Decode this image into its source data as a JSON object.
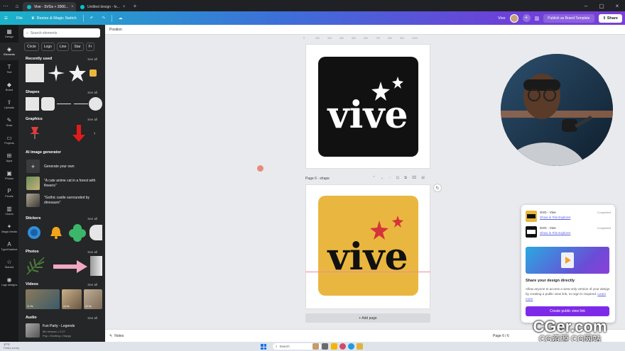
{
  "browser": {
    "tabs": [
      {
        "label": "Vive - SVGs + 2000..."
      },
      {
        "label": "Untitled design - fe..."
      }
    ]
  },
  "header": {
    "file": "File",
    "resize": "Resize & Magic Switch",
    "user_name": "Vive",
    "publish": "Publish as Brand Template",
    "share": "Share"
  },
  "rail": {
    "items": [
      {
        "label": "Design",
        "icon": "layout-icon"
      },
      {
        "label": "Elements",
        "icon": "shapes-icon"
      },
      {
        "label": "Text",
        "icon": "text-icon"
      },
      {
        "label": "Brand",
        "icon": "brand-icon"
      },
      {
        "label": "Uploads",
        "icon": "upload-icon"
      },
      {
        "label": "Draw",
        "icon": "pen-icon"
      },
      {
        "label": "Projects",
        "icon": "folder-icon"
      },
      {
        "label": "Apps",
        "icon": "apps-icon"
      },
      {
        "label": "Photos",
        "icon": "photo-icon"
      },
      {
        "label": "Pexels",
        "icon": "pexels-icon"
      },
      {
        "label": "Charts",
        "icon": "chart-icon"
      },
      {
        "label": "Magic Media",
        "icon": "magic-icon"
      },
      {
        "label": "TypeGradient",
        "icon": "type-icon"
      },
      {
        "label": "Starred",
        "icon": "star-icon"
      },
      {
        "label": "Logo designs",
        "icon": "logo-icon"
      }
    ]
  },
  "panel": {
    "search_placeholder": "Search elements",
    "chips": [
      "Circle",
      "Logo",
      "Line",
      "Star",
      "Fr"
    ],
    "see_all": "See all",
    "sections": {
      "recently_used": "Recently used",
      "shapes": "Shapes",
      "graphics": "Graphics",
      "ai_generator": "AI image generator",
      "stickers": "Stickers",
      "photos": "Photos",
      "videos": "Videos",
      "audio": "Audio"
    },
    "ai": {
      "generate": "Generate your own",
      "prompt1": "\"A cute anime cat in a forest with flowers\"",
      "prompt2": "\"Gothic castle surrounded by dinosaurs\""
    },
    "videos": [
      {
        "duration": "11.0s"
      },
      {
        "duration": "14.0s"
      },
      {
        "duration": "12.0s"
      }
    ],
    "audio": {
      "title": "Fun Party - Legends",
      "artist": "5th Heaven • 2:27",
      "tags": "Pop • Exciting • Happy"
    }
  },
  "canvas": {
    "position": "Position",
    "ruler": [
      "0",
      "200",
      "300",
      "400",
      "500",
      "600",
      "700",
      "800",
      "900",
      "1000"
    ],
    "page6_label": "Page 6 - shape",
    "add_page": "+ Add page",
    "notes": "Notes",
    "page_count": "Page 6 / 6",
    "logo_text": "vive"
  },
  "popup": {
    "items": [
      {
        "title": "SVG - Vive",
        "link": "Show in File Explorer",
        "status": "Completed"
      },
      {
        "title": "SVG - Vive",
        "link": "Show in File Explorer",
        "status": "Completed"
      }
    ],
    "heading": "Share your design directly",
    "body": "Allow anyone to access a view-only version of your design by creating a public view link, no sign-in required.",
    "learn_more": "Learn more",
    "button": "Create public view link"
  },
  "watermark": {
    "line1": "CGer.com",
    "line2": "CG资源  CG网站"
  },
  "taskbar": {
    "temp": "17°C",
    "weather": "Partly sunny",
    "search": "Search"
  },
  "colors": {
    "accent": "#7d2ae8",
    "logo_red": "#d6333a",
    "tile_yellow": "#e9b73f",
    "tile_black": "#111111"
  }
}
